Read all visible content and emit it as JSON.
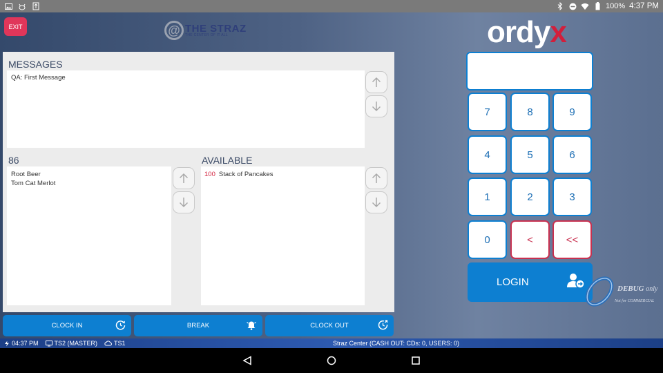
{
  "status_bar": {
    "battery": "100%",
    "time": "4:37 PM",
    "left_icons": [
      "image-icon",
      "cat-icon",
      "usb-icon"
    ],
    "right_icons": [
      "bluetooth-icon",
      "do-not-disturb-icon",
      "wifi-icon",
      "battery-icon"
    ]
  },
  "header": {
    "exit_label": "EXIT",
    "venue_logo": {
      "name": "THE STRAZ",
      "tagline": "THE CENTER OF IT ALL"
    },
    "brand_logo": {
      "text": "ordy",
      "accent": "x"
    }
  },
  "messages": {
    "title": "MESSAGES",
    "items": [
      "QA: First Message"
    ]
  },
  "eighty_six": {
    "title": "86",
    "items": [
      "Root Beer",
      "Tom Cat Merlot"
    ]
  },
  "available": {
    "title": "AVAILABLE",
    "items": [
      {
        "qty": "100",
        "name": "Stack of Pancakes"
      }
    ]
  },
  "actions": {
    "clock_in": "CLOCK IN",
    "break": "BREAK",
    "clock_out": "CLOCK OUT"
  },
  "keypad": {
    "pin_value": "",
    "keys": [
      "7",
      "8",
      "9",
      "4",
      "5",
      "6",
      "1",
      "2",
      "3",
      "0",
      "<",
      "<<"
    ],
    "login_label": "LOGIN"
  },
  "debug": {
    "title": "DEBUG",
    "suffix": "only",
    "subtitle": "Not for COMMERCIAL"
  },
  "info_bar": {
    "time": "04:37 PM",
    "terminal": "TS2 (MASTER)",
    "peer": "TS1",
    "center_status": "Straz Center (CASH OUT: CDs: 0, USERS: 0)"
  },
  "colors": {
    "accent_blue": "#0d7fd1",
    "exit_red": "#e0365a",
    "brand_red": "#d21f3c",
    "info_bar": "#2d5ab0"
  }
}
